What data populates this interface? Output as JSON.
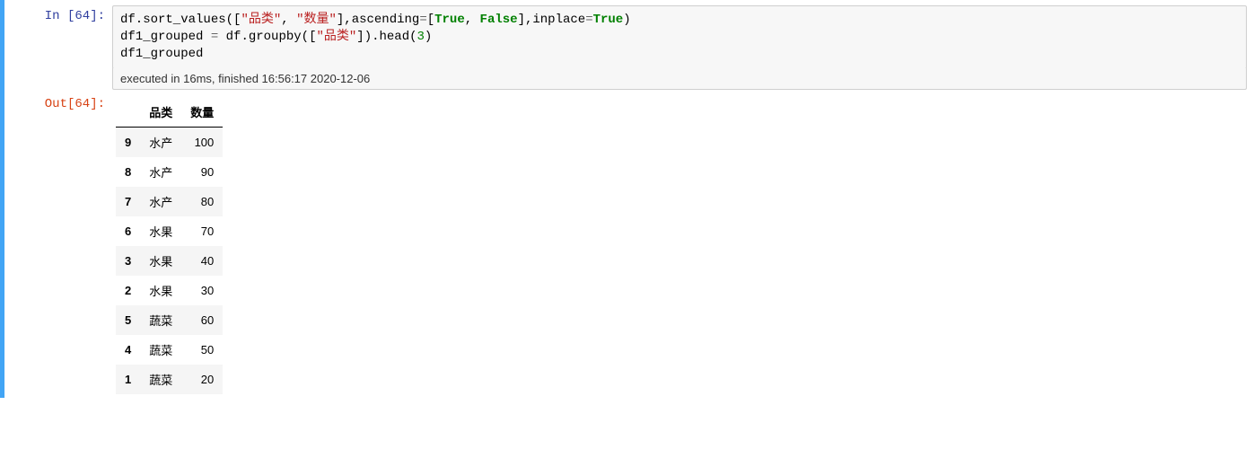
{
  "in_prompt": "In  [64]:",
  "out_prompt": "Out[64]:",
  "code": {
    "fn1": "df.sort_values",
    "lb": "(",
    "lbr": "[",
    "str1": "\"品类\"",
    "comma": ",",
    "sp": " ",
    "str2": "\"数量\"",
    "rbr": "]",
    "arg_asc": "ascending",
    "eq": "=",
    "true": "True",
    "false": "False",
    "arg_inp": "inplace",
    "rb": ")",
    "line2a": "df1_grouped ",
    "line2b": " df.groupby",
    "str3": "\"品类\"",
    "head": ".head",
    "num3": "3",
    "line3": "df1_grouped"
  },
  "exec_info": "executed in 16ms, finished 16:56:17 2020-12-06",
  "table": {
    "columns": [
      "品类",
      "数量"
    ],
    "rows": [
      {
        "idx": "9",
        "cat": "水产",
        "qty": "100"
      },
      {
        "idx": "8",
        "cat": "水产",
        "qty": "90"
      },
      {
        "idx": "7",
        "cat": "水产",
        "qty": "80"
      },
      {
        "idx": "6",
        "cat": "水果",
        "qty": "70"
      },
      {
        "idx": "3",
        "cat": "水果",
        "qty": "40"
      },
      {
        "idx": "2",
        "cat": "水果",
        "qty": "30"
      },
      {
        "idx": "5",
        "cat": "蔬菜",
        "qty": "60"
      },
      {
        "idx": "4",
        "cat": "蔬菜",
        "qty": "50"
      },
      {
        "idx": "1",
        "cat": "蔬菜",
        "qty": "20"
      }
    ]
  }
}
